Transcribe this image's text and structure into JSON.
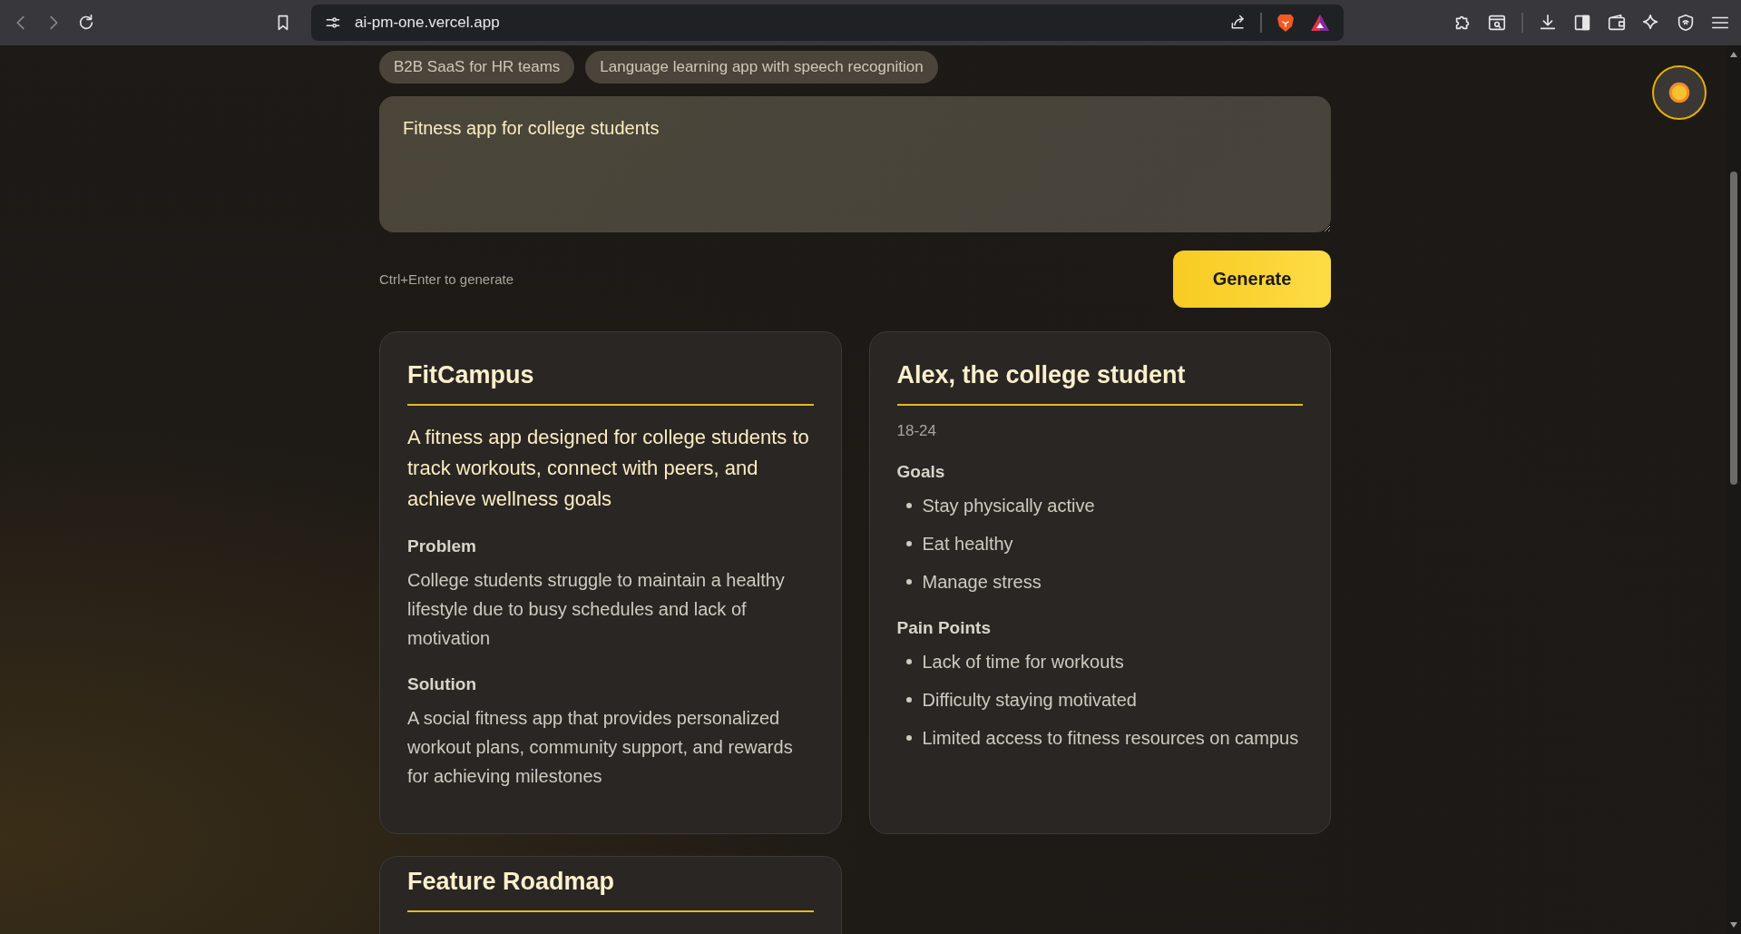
{
  "browser": {
    "url": "ai-pm-one.vercel.app"
  },
  "examples": [
    {
      "label": "B2B SaaS for HR teams"
    },
    {
      "label": "Language learning app with speech recognition"
    }
  ],
  "prompt": {
    "value": "Fitness app for college students",
    "hint": "Ctrl+Enter to generate",
    "button": "Generate"
  },
  "product_card": {
    "title": "FitCampus",
    "summary": "A fitness app designed for college students to track workouts, connect with peers, and achieve wellness goals",
    "sections": [
      {
        "heading": "Problem",
        "text": "College students struggle to maintain a healthy lifestyle due to busy schedules and lack of motivation"
      },
      {
        "heading": "Solution",
        "text": "A social fitness app that provides personalized workout plans, community support, and rewards for achieving milestones"
      }
    ]
  },
  "persona_card": {
    "title": "Alex, the college student",
    "age": "18-24",
    "lists": [
      {
        "heading": "Goals",
        "items": [
          "Stay physically active",
          "Eat healthy",
          "Manage stress"
        ]
      },
      {
        "heading": "Pain Points",
        "items": [
          "Lack of time for workouts",
          "Difficulty staying motivated",
          "Limited access to fitness resources on campus"
        ]
      }
    ]
  },
  "roadmap_card": {
    "title": "Feature Roadmap"
  }
}
